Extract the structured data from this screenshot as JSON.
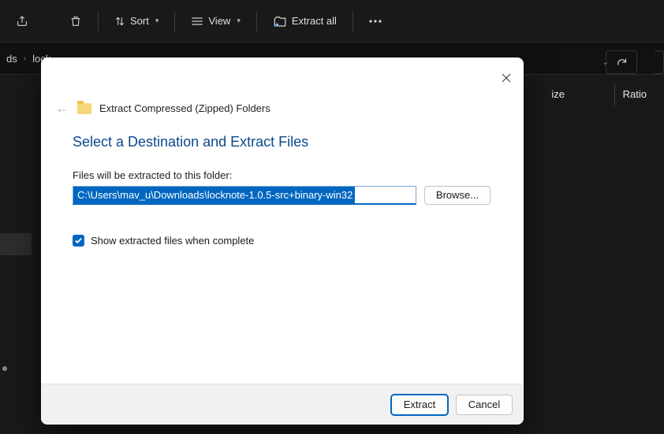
{
  "toolbar": {
    "sort_label": "Sort",
    "view_label": "View",
    "extract_all_label": "Extract all"
  },
  "breadcrumb": {
    "seg1": "ds",
    "seg2": "lock"
  },
  "columns": {
    "size": "ize",
    "ratio": "Ratio"
  },
  "dialog": {
    "title": "Extract Compressed (Zipped) Folders",
    "headline": "Select a Destination and Extract Files",
    "folder_label": "Files will be extracted to this folder:",
    "path_value": "C:\\Users\\mav_u\\Downloads\\locknote-1.0.5-src+binary-win32",
    "browse_label": "Browse...",
    "checkbox_label": "Show extracted files when complete",
    "extract_label": "Extract",
    "cancel_label": "Cancel"
  }
}
